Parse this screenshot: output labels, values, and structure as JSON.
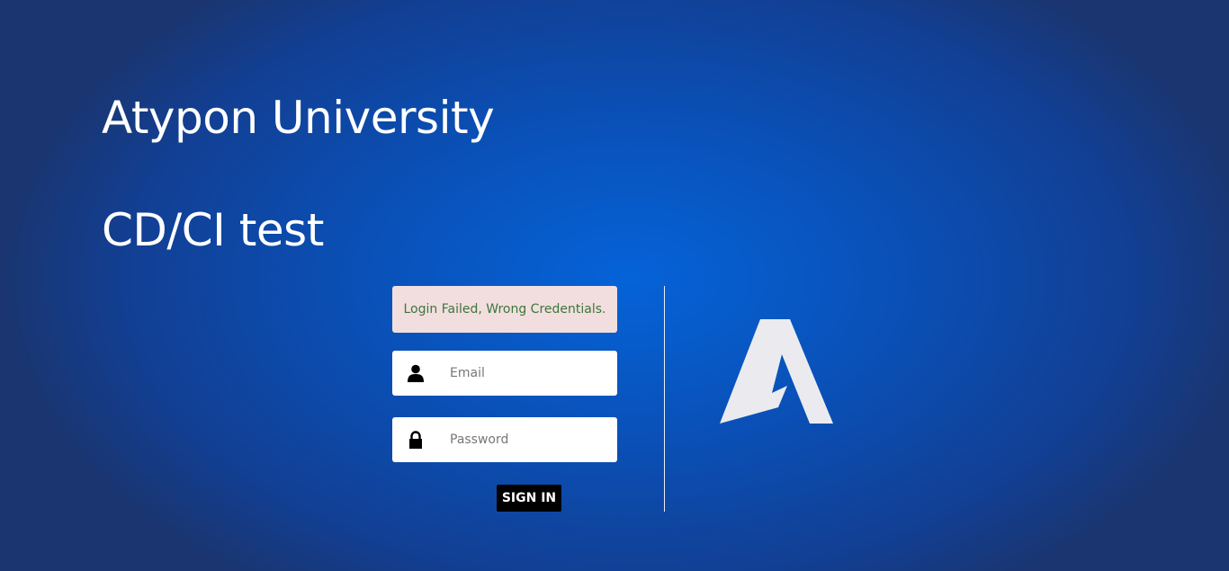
{
  "header": {
    "title": "Atypon University",
    "subtitle": "CD/CI test"
  },
  "login": {
    "error_message": "Login Failed, Wrong Credentials.",
    "email": {
      "placeholder": "Email",
      "value": "",
      "icon": "user-icon"
    },
    "password": {
      "placeholder": "Password",
      "value": "",
      "icon": "lock-icon"
    },
    "signin_label": "SIGN IN"
  },
  "colors": {
    "background": "#0a4fb5",
    "alert_background": "#f2dede",
    "alert_text": "#3c763d",
    "button": "#000000",
    "logo": "#ebebef"
  },
  "logo": {
    "icon": "atypon-logo-icon"
  }
}
